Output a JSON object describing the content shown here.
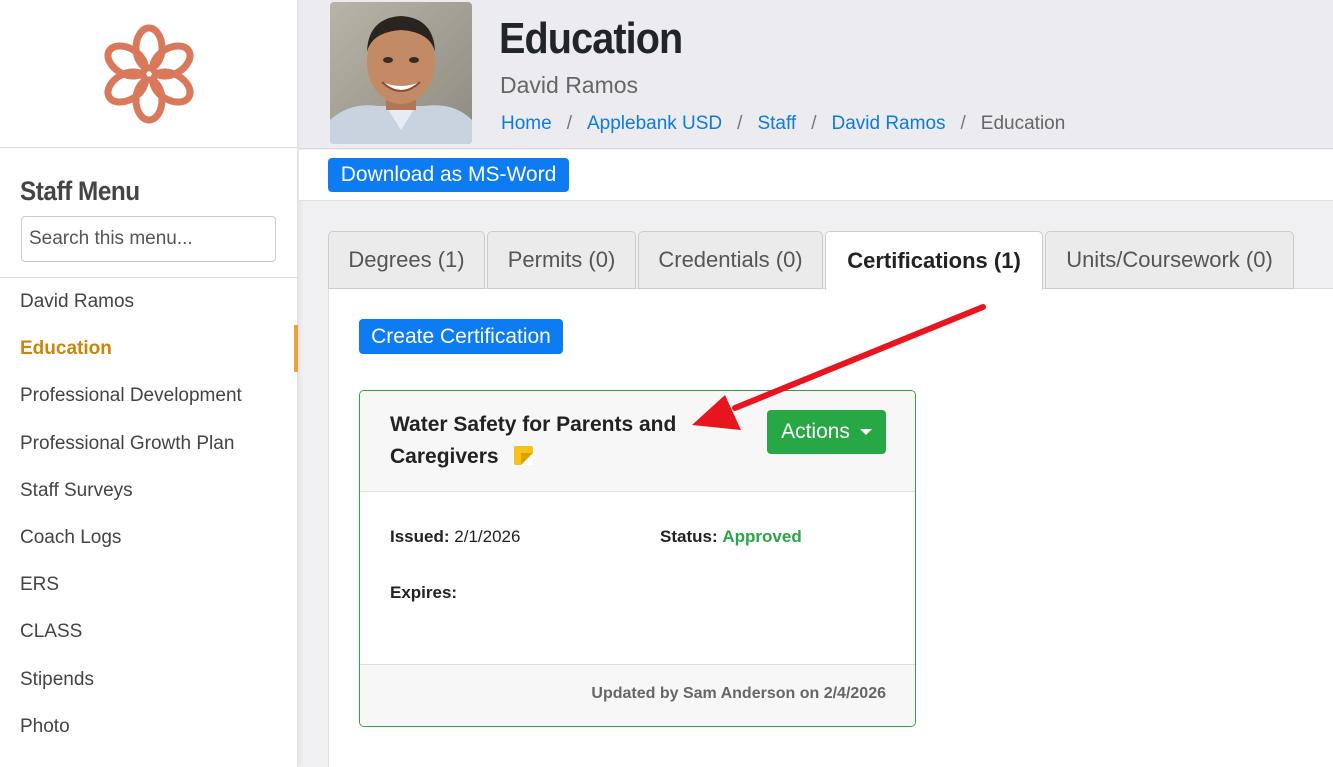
{
  "sidebar": {
    "menu_title": "Staff Menu",
    "search_placeholder": "Search this menu...",
    "items": [
      {
        "label": "David Ramos",
        "active": false
      },
      {
        "label": "Education",
        "active": true
      },
      {
        "label": "Professional Development",
        "active": false
      },
      {
        "label": "Professional Growth Plan",
        "active": false
      },
      {
        "label": "Staff Surveys",
        "active": false
      },
      {
        "label": "Coach Logs",
        "active": false
      },
      {
        "label": "ERS",
        "active": false
      },
      {
        "label": "CLASS",
        "active": false
      },
      {
        "label": "Stipends",
        "active": false
      },
      {
        "label": "Photo",
        "active": false
      }
    ]
  },
  "header": {
    "title": "Education",
    "subtitle": "David Ramos",
    "breadcrumb": [
      "Home",
      "Applebank USD",
      "Staff",
      "David Ramos"
    ],
    "breadcrumb_current": "Education",
    "breadcrumb_sep": "/"
  },
  "toolbar": {
    "download_label": "Download as MS-Word"
  },
  "tabs": [
    {
      "label": "Degrees (1)",
      "active": false
    },
    {
      "label": "Permits (0)",
      "active": false
    },
    {
      "label": "Credentials (0)",
      "active": false
    },
    {
      "label": "Certifications (1)",
      "active": true
    },
    {
      "label": "Units/Coursework (0)",
      "active": false
    }
  ],
  "content": {
    "create_label": "Create Certification",
    "card": {
      "title": "Water Safety for Parents and Caregivers",
      "actions_label": "Actions",
      "issued_label": "Issued:",
      "issued_value": "2/1/2026",
      "status_label": "Status:",
      "status_value": "Approved",
      "expires_label": "Expires:",
      "expires_value": "",
      "footer": "Updated by Sam Anderson on 2/4/2026"
    }
  },
  "colors": {
    "accent_blue": "#0d7cf2",
    "success_green": "#28a745",
    "active_menu": "#c8860a",
    "logo": "#d9785a",
    "annotation_arrow": "#e8141e"
  },
  "icons": {
    "logo": "flower-logo-icon",
    "note": "sticky-note-icon",
    "dropdown": "caret-down-icon",
    "annotation": "red-arrow-annotation"
  }
}
